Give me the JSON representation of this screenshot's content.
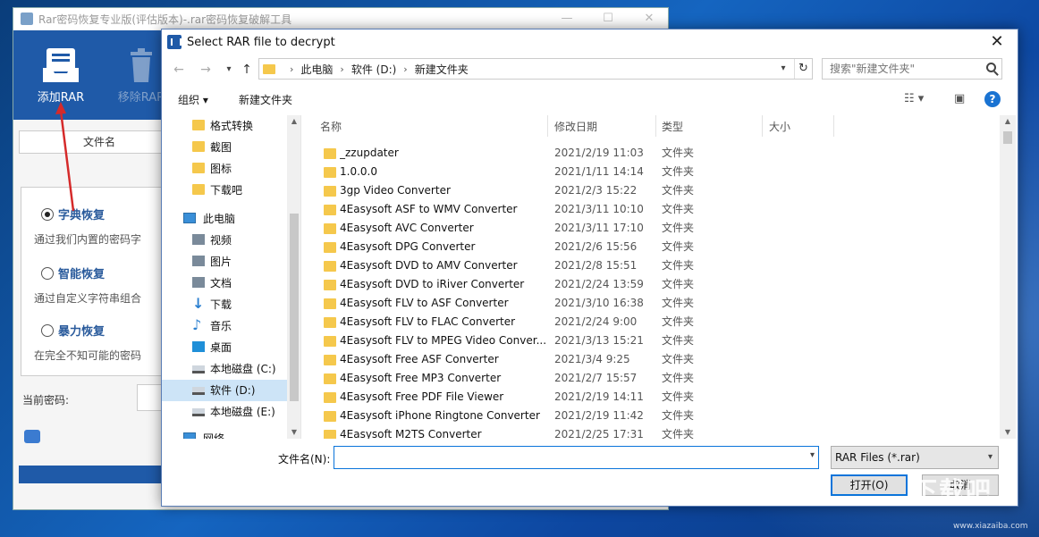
{
  "app": {
    "title": "Rar密码恢复专业版(评估版本)-.rar密码恢复破解工具",
    "window_controls": [
      "—",
      "☐",
      "✕"
    ],
    "toolbar": {
      "add_label": "添加RAR",
      "remove_label": "移除RAR"
    },
    "file_column": "文件名",
    "modes": [
      {
        "title": "字典恢复",
        "desc": "通过我们内置的密码字",
        "selected": true
      },
      {
        "title": "智能恢复",
        "desc": "通过自定义字符串组合",
        "selected": false
      },
      {
        "title": "暴力恢复",
        "desc": "在完全不知可能的密码",
        "selected": false
      }
    ],
    "current_password_label": "当前密码:"
  },
  "dialog": {
    "title": "Select RAR file to decrypt",
    "close": "✕",
    "nav": {
      "back": "←",
      "forward": "→",
      "up": "↑"
    },
    "breadcrumb": [
      "此电脑",
      "软件 (D:)",
      "新建文件夹"
    ],
    "search_placeholder": "搜索\"新建文件夹\"",
    "organize": "组织 ▾",
    "new_folder": "新建文件夹",
    "help": "?",
    "sidebar": [
      {
        "label": "格式转换",
        "icon": "folder-icon"
      },
      {
        "label": "截图",
        "icon": "folder-icon"
      },
      {
        "label": "图标",
        "icon": "folder-icon"
      },
      {
        "label": "下载吧",
        "icon": "folder-icon"
      },
      {
        "label": "此电脑",
        "icon": "computer-icon"
      },
      {
        "label": "视频",
        "icon": "video-icon"
      },
      {
        "label": "图片",
        "icon": "pictures-icon"
      },
      {
        "label": "文档",
        "icon": "documents-icon"
      },
      {
        "label": "下载",
        "icon": "download-icon"
      },
      {
        "label": "音乐",
        "icon": "music-icon"
      },
      {
        "label": "桌面",
        "icon": "desktop-icon"
      },
      {
        "label": "本地磁盘 (C:)",
        "icon": "drive-icon"
      },
      {
        "label": "软件 (D:)",
        "icon": "drive-icon",
        "selected": true
      },
      {
        "label": "本地磁盘 (E:)",
        "icon": "drive-icon"
      },
      {
        "label": "网络",
        "icon": "network-icon"
      }
    ],
    "columns": {
      "name": "名称",
      "date": "修改日期",
      "type": "类型",
      "size": "大小"
    },
    "files": [
      {
        "name": "_zzupdater",
        "date": "2021/2/19 11:03",
        "type": "文件夹"
      },
      {
        "name": "1.0.0.0",
        "date": "2021/1/11 14:14",
        "type": "文件夹"
      },
      {
        "name": "3gp Video Converter",
        "date": "2021/2/3 15:22",
        "type": "文件夹"
      },
      {
        "name": "4Easysoft ASF to WMV Converter",
        "date": "2021/3/11 10:10",
        "type": "文件夹"
      },
      {
        "name": "4Easysoft AVC Converter",
        "date": "2021/3/11 17:10",
        "type": "文件夹"
      },
      {
        "name": "4Easysoft DPG Converter",
        "date": "2021/2/6 15:56",
        "type": "文件夹"
      },
      {
        "name": "4Easysoft DVD to AMV Converter",
        "date": "2021/2/8 15:51",
        "type": "文件夹"
      },
      {
        "name": "4Easysoft DVD to iRiver Converter",
        "date": "2021/2/24 13:59",
        "type": "文件夹"
      },
      {
        "name": "4Easysoft FLV to ASF Converter",
        "date": "2021/3/10 16:38",
        "type": "文件夹"
      },
      {
        "name": "4Easysoft FLV to FLAC Converter",
        "date": "2021/2/24 9:00",
        "type": "文件夹"
      },
      {
        "name": "4Easysoft FLV to MPEG Video Conver...",
        "date": "2021/3/13 15:21",
        "type": "文件夹"
      },
      {
        "name": "4Easysoft Free ASF Converter",
        "date": "2021/3/4 9:25",
        "type": "文件夹"
      },
      {
        "name": "4Easysoft Free MP3 Converter",
        "date": "2021/2/7 15:57",
        "type": "文件夹"
      },
      {
        "name": "4Easysoft Free PDF File Viewer",
        "date": "2021/2/19 14:11",
        "type": "文件夹"
      },
      {
        "name": "4Easysoft iPhone Ringtone Converter",
        "date": "2021/2/19 11:42",
        "type": "文件夹"
      },
      {
        "name": "4Easysoft M2TS Converter",
        "date": "2021/2/25 17:31",
        "type": "文件夹"
      }
    ],
    "filename_label": "文件名(N):",
    "filename_value": "",
    "filter": "RAR Files (*.rar)",
    "open_button": "打开(O)",
    "cancel_button": "取消"
  },
  "watermark": {
    "main": "下载吧",
    "sub": "www.xiazaiba.com"
  }
}
